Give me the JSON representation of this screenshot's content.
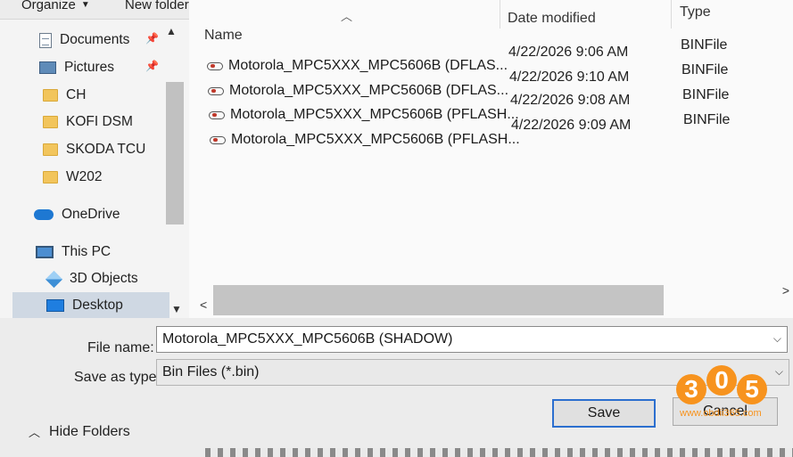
{
  "toolbar": {
    "organize_label": "Organize",
    "new_folder_label": "New folder"
  },
  "nav": {
    "items": [
      {
        "label": "Documents",
        "icon": "documents-icon",
        "pinned": true
      },
      {
        "label": "Pictures",
        "icon": "pictures-icon",
        "pinned": true
      },
      {
        "label": "CH",
        "icon": "folder-icon"
      },
      {
        "label": "KOFI DSM",
        "icon": "folder-icon"
      },
      {
        "label": "SKODA TCU",
        "icon": "folder-icon"
      },
      {
        "label": "W202",
        "icon": "folder-icon"
      },
      {
        "label": "OneDrive",
        "icon": "onedrive-icon"
      },
      {
        "label": "This PC",
        "icon": "this-pc-icon"
      },
      {
        "label": "3D Objects",
        "icon": "3d-objects-icon"
      },
      {
        "label": "Desktop",
        "icon": "desktop-icon",
        "selected": true
      }
    ]
  },
  "filelist": {
    "columns": {
      "name": "Name",
      "date": "Date modified",
      "type": "Type"
    },
    "rows": [
      {
        "name": "Motorola_MPC5XXX_MPC5606B (DFLAS...",
        "date": "4/22/2026 9:06 AM",
        "type": "BINFile"
      },
      {
        "name": "Motorola_MPC5XXX_MPC5606B (DFLAS...",
        "date": "4/22/2026 9:10 AM",
        "type": "BINFile"
      },
      {
        "name": "Motorola_MPC5XXX_MPC5606B (PFLASH...",
        "date": "4/22/2026 9:08 AM",
        "type": "BINFile"
      },
      {
        "name": "Motorola_MPC5XXX_MPC5606B (PFLASH...",
        "date": "4/22/2026 9:09 AM",
        "type": "BINFile"
      }
    ]
  },
  "form": {
    "file_name_label": "File name:",
    "file_name_value": "Motorola_MPC5XXX_MPC5606B (SHADOW)",
    "save_as_type_label": "Save as type:",
    "save_as_type_value": "Bin Files (*.bin)"
  },
  "buttons": {
    "save_label": "Save",
    "cancel_label": "Cancel",
    "hide_folders_label": "Hide Folders"
  },
  "watermark": {
    "digits": [
      "3",
      "0",
      "5"
    ],
    "url": "www.obdii365.com",
    "color": "#f7931e"
  }
}
